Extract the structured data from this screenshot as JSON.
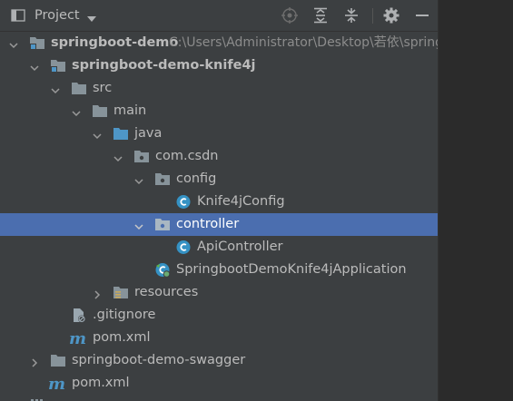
{
  "header": {
    "title": "Project",
    "icon": "project-view-icon",
    "toolbar": [
      "locate-icon",
      "expand-all-icon",
      "collapse-all-icon",
      "gear-icon",
      "minimize-icon"
    ]
  },
  "tree": {
    "root": {
      "label": "springboot-demo",
      "path": "C:\\Users\\Administrator\\Desktop\\若依\\spring"
    },
    "module1": {
      "label": "springboot-demo-knife4j"
    },
    "src": {
      "label": "src"
    },
    "main": {
      "label": "main"
    },
    "java": {
      "label": "java"
    },
    "package": {
      "label": "com.csdn"
    },
    "config": {
      "label": "config"
    },
    "knife4jconfig": {
      "label": "Knife4jConfig"
    },
    "controller": {
      "label": "controller"
    },
    "apicontroller": {
      "label": "ApiController"
    },
    "application": {
      "label": "SpringbootDemoKnife4jApplication"
    },
    "resources": {
      "label": "resources"
    },
    "gitignore": {
      "label": ".gitignore"
    },
    "pom1": {
      "label": "pom.xml"
    },
    "module2": {
      "label": "springboot-demo-swagger"
    },
    "pom2": {
      "label": "pom.xml"
    }
  },
  "colors": {
    "panel": "#3c3f41",
    "selection": "#4b6eaf",
    "text": "#bbbbbb",
    "folder": "#87939a",
    "source_folder": "#4e96c7",
    "class_icon": "#3592c4",
    "maven": "#4e96c7"
  }
}
